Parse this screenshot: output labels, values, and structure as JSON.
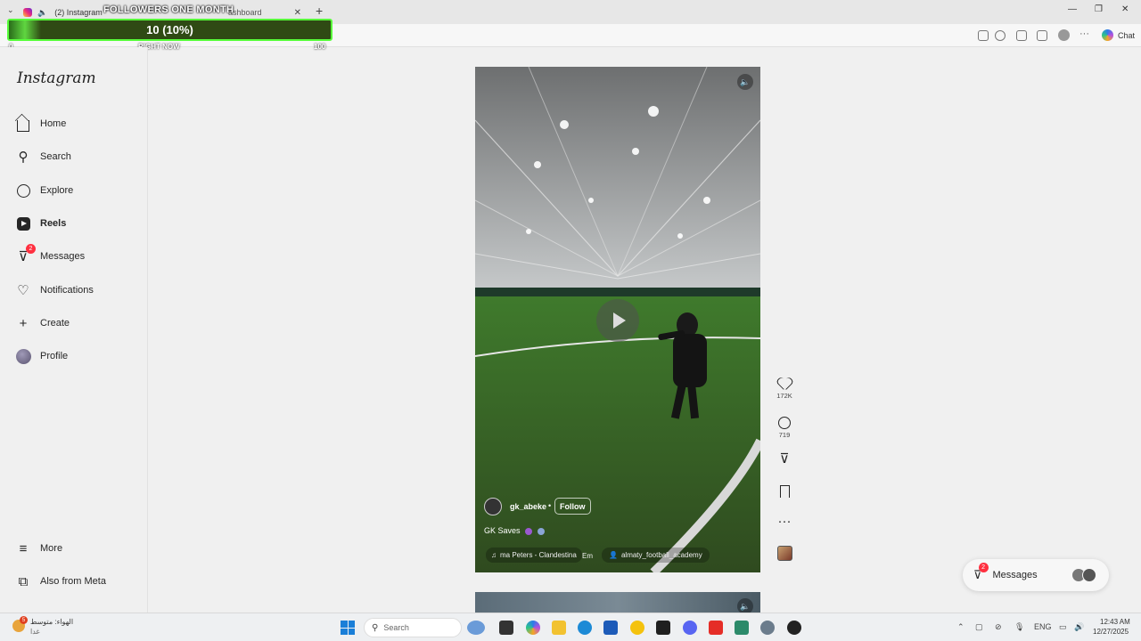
{
  "browser": {
    "tab_title": "(2) Instagram",
    "tab2_title": "ashboard",
    "new_tab": "+",
    "chat_label": "Chat"
  },
  "overlay": {
    "title": "FOLLOWERS ONE MONTH",
    "value_text": "10 (10%)",
    "progress_percent": 10,
    "min_label": "0",
    "mid_label": "RIGHT NOW",
    "max_label": "100",
    "bar_color": "#57ff3a"
  },
  "sidebar": {
    "logo": "Instagram",
    "items": [
      {
        "label": "Home",
        "icon": "home-icon"
      },
      {
        "label": "Search",
        "icon": "search-icon"
      },
      {
        "label": "Explore",
        "icon": "compass-icon"
      },
      {
        "label": "Reels",
        "icon": "reels-icon",
        "active": true
      },
      {
        "label": "Messages",
        "icon": "messenger-icon",
        "badge": "2"
      },
      {
        "label": "Notifications",
        "icon": "heart-icon"
      },
      {
        "label": "Create",
        "icon": "plus-icon"
      },
      {
        "label": "Profile",
        "icon": "profile-avatar"
      }
    ],
    "more": "More",
    "meta": "Also from Meta"
  },
  "reel": {
    "author": "gk_abeke",
    "separator": "•",
    "follow": "Follow",
    "caption": "GK Saves",
    "music": "ma Peters - Clandestina",
    "music_extra": "Em",
    "tagged": "almaty_football_academy"
  },
  "actions": {
    "likes": "172K",
    "comments": "719"
  },
  "messages_pill": {
    "label": "Messages",
    "badge": "2"
  },
  "taskbar": {
    "weather_line1": "الهواء: متوسط",
    "weather_line2": "غدا",
    "weather_badge": "5",
    "search_placeholder": "Search",
    "lang": "ENG",
    "time": "12:43 AM",
    "date": "12/27/2025"
  }
}
